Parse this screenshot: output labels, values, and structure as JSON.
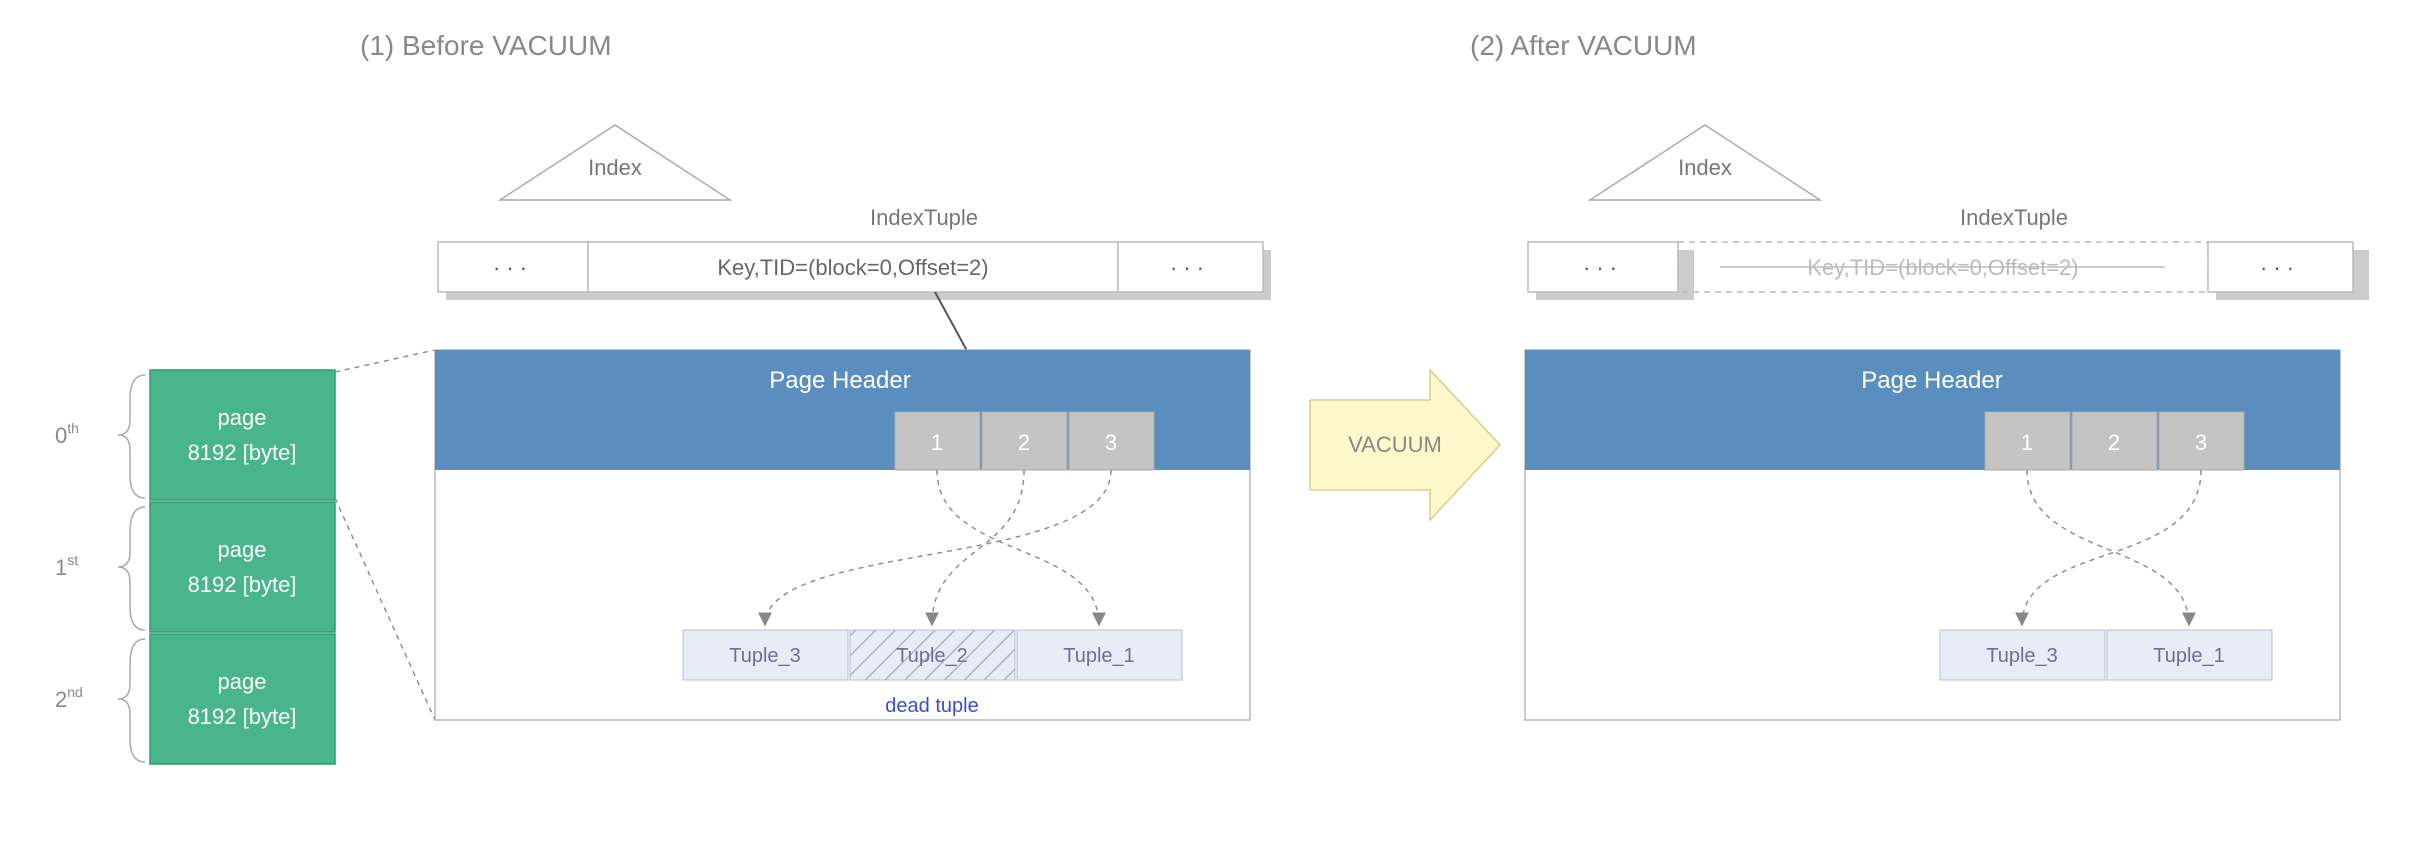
{
  "titles": {
    "before": "(1) Before VACUUM",
    "after": "(2) After VACUUM"
  },
  "ordinals": {
    "zero": "0",
    "zero_sup": "th",
    "one": "1",
    "one_sup": "st",
    "two": "2",
    "two_sup": "nd"
  },
  "page_label_line1": "page",
  "page_label_line2": "8192 [byte]",
  "index_label": "Index",
  "indextuple_label": "IndexTuple",
  "index_entry": "Key,TID=(block=0,Offset=2)",
  "ellipsis": "···",
  "page_header": "Page Header",
  "slots": {
    "s1": "1",
    "s2": "2",
    "s3": "3"
  },
  "tuples": {
    "t1": "Tuple_1",
    "t2": "Tuple_2",
    "t3": "Tuple_3"
  },
  "dead_tuple": "dead tuple",
  "vacuum": "VACUUM"
}
